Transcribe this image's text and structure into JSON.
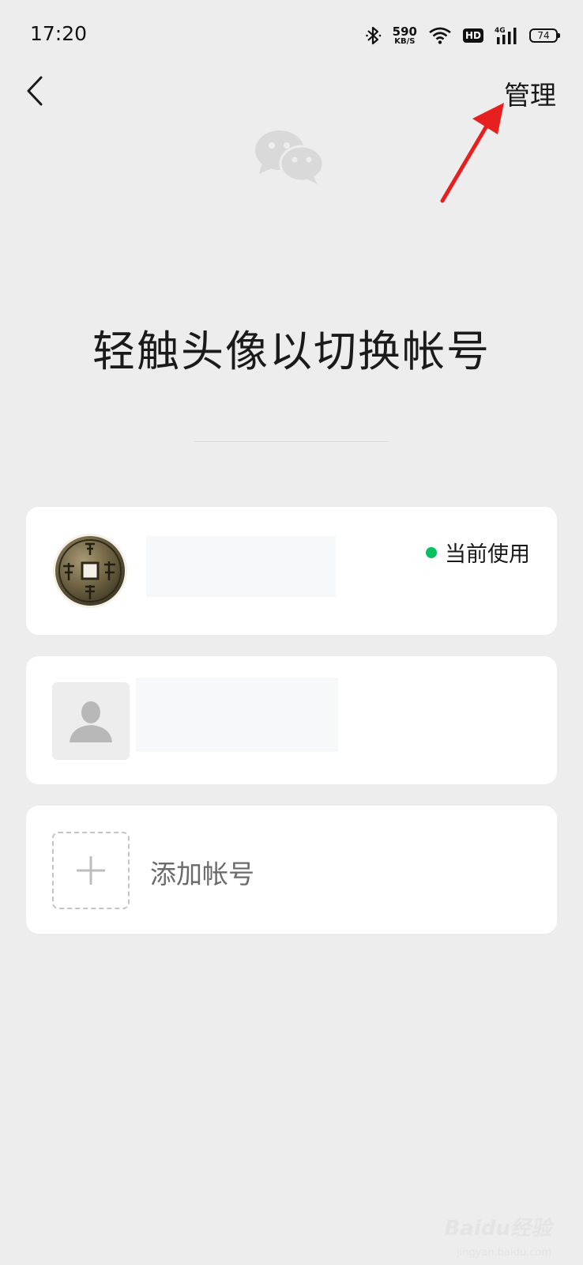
{
  "status_bar": {
    "time": "17:20",
    "net_speed_value": "590",
    "net_speed_unit": "KB/S",
    "hd_label": "HD",
    "network_type": "4G",
    "battery_level": "74",
    "icons": [
      "bluetooth-icon",
      "wifi-icon",
      "hd-icon",
      "signal-icon",
      "battery-icon"
    ]
  },
  "nav": {
    "back_icon": "chevron-left-icon",
    "manage_label": "管理"
  },
  "page": {
    "logo_icon": "wechat-logo-icon",
    "title": "轻触头像以切换帐号"
  },
  "accounts": [
    {
      "avatar": "coin-avatar",
      "status_label": "当前使用",
      "status_color": "#07c160"
    },
    {
      "avatar": "default-user-avatar"
    }
  ],
  "add_account": {
    "label": "添加帐号",
    "icon": "plus-icon"
  },
  "colors": {
    "background": "#ededed",
    "card": "#ffffff",
    "accent_green": "#07c160",
    "annotation_red": "#e81f1f"
  },
  "watermark": {
    "brand": "Baidu经验",
    "domain": "jingyan.baidu.com"
  }
}
